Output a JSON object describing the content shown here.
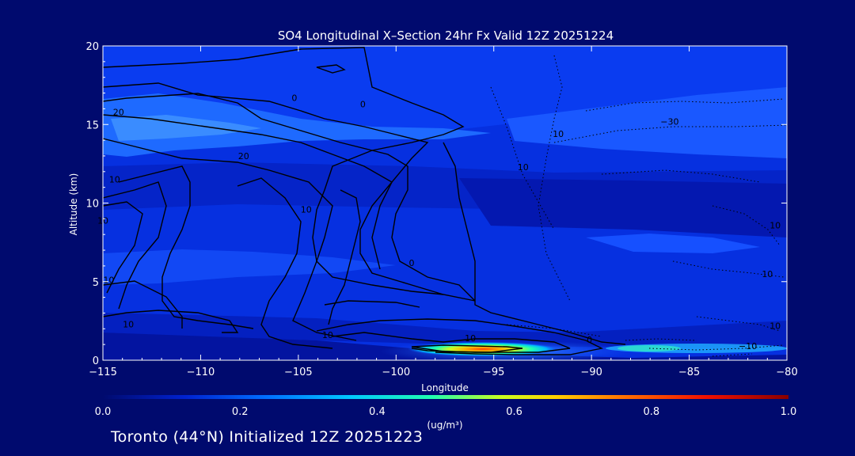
{
  "chart_data": {
    "type": "heatmap",
    "title": "SO4 Longitudinal X–Section 24hr  Fx Valid 12Z 20251224",
    "xlabel": "Longitude",
    "ylabel": "Altitude (km)",
    "xlim": [
      -115,
      -80
    ],
    "ylim": [
      0,
      20
    ],
    "x_ticks": [
      -115,
      -110,
      -105,
      -100,
      -95,
      -90,
      -85,
      -80
    ],
    "x_tick_labels": [
      "−115",
      "−110",
      "−105",
      "−100",
      "−95",
      "−90",
      "−85",
      "−80"
    ],
    "y_ticks": [
      0,
      5,
      10,
      15,
      20
    ],
    "y_tick_labels": [
      "0",
      "5",
      "10",
      "15",
      "20"
    ],
    "colorbar": {
      "min": 0.0,
      "max": 1.0,
      "ticks": [
        0.0,
        0.2,
        0.4,
        0.6,
        0.8,
        1.0
      ],
      "tick_labels": [
        "0.0",
        "0.2",
        "0.4",
        "0.6",
        "0.8",
        "1.0"
      ],
      "units_label": "(ug/m³)",
      "colors": [
        "#001a8c",
        "#0030e8",
        "#0a6aff",
        "#00c8ff",
        "#40ff90",
        "#f0ff00",
        "#ff8c00",
        "#ff1a00",
        "#900000"
      ]
    },
    "concentration_field": {
      "description_units": "ug/m3",
      "features": [
        {
          "name": "background",
          "value": 0.06
        },
        {
          "name": "upper-layer-plume",
          "lon": [
            -115,
            -100
          ],
          "alt": [
            12.5,
            16.5
          ],
          "value": 0.15
        },
        {
          "name": "boundary-layer-maximum",
          "lon": -96,
          "alt": 0.7,
          "value": 0.45
        },
        {
          "name": "eastern-surface-band",
          "lon": [
            -88,
            -80
          ],
          "alt": [
            0.2,
            1.2
          ],
          "value": 0.2
        }
      ]
    },
    "contour_labels": [
      {
        "text": "20",
        "lon": -114.2,
        "alt": 15.6
      },
      {
        "text": "20",
        "lon": -107.8,
        "alt": 12.8
      },
      {
        "text": "0",
        "lon": -105.2,
        "alt": 16.5
      },
      {
        "text": "0",
        "lon": -101.7,
        "alt": 16.1
      },
      {
        "text": "10",
        "lon": -114.4,
        "alt": 11.3
      },
      {
        "text": "10",
        "lon": -104.6,
        "alt": 9.4
      },
      {
        "text": "10",
        "lon": -115,
        "alt": 8.7
      },
      {
        "text": "10",
        "lon": -114.7,
        "alt": 4.9
      },
      {
        "text": "10",
        "lon": -113.7,
        "alt": 2.1
      },
      {
        "text": "0",
        "lon": -99.2,
        "alt": 6.0
      },
      {
        "text": "10",
        "lon": -96.2,
        "alt": 1.2
      },
      {
        "text": "0",
        "lon": -90.1,
        "alt": 1.1
      },
      {
        "text": "10",
        "lon": -103.5,
        "alt": 1.4
      },
      {
        "text": "10",
        "lon": -91.7,
        "alt": 14.2
      },
      {
        "text": "10",
        "lon": -93.5,
        "alt": 12.1
      },
      {
        "text": "−30",
        "lon": -86.0,
        "alt": 15.0
      },
      {
        "text": "10",
        "lon": -80.6,
        "alt": 8.4
      },
      {
        "text": "10",
        "lon": -81.0,
        "alt": 5.3
      },
      {
        "text": "10",
        "lon": -80.6,
        "alt": 2.0
      },
      {
        "text": "−10",
        "lon": -82.0,
        "alt": 0.7
      }
    ]
  },
  "footer": {
    "caption": "Toronto (44°N) Initialized 12Z 20251223"
  }
}
